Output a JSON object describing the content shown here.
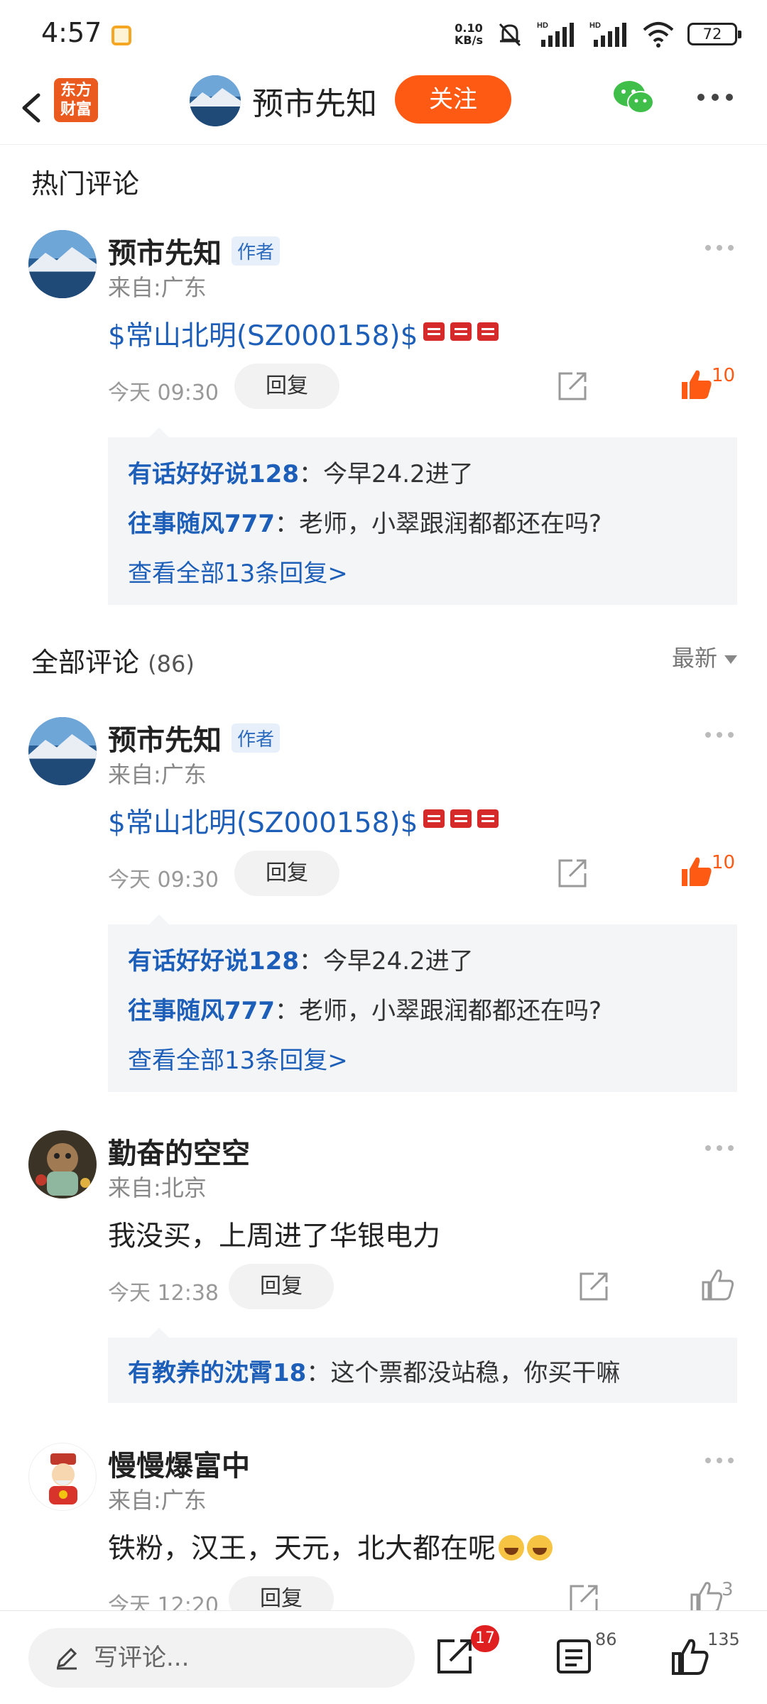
{
  "status_bar": {
    "time": "4:57",
    "speed_top": "0.10",
    "speed_bottom": "KB/s",
    "battery": "72",
    "icons": [
      "app-notification-icon",
      "mute-bell-icon",
      "hd-signal-icon",
      "hd-signal-icon",
      "wifi-icon",
      "battery-icon"
    ]
  },
  "header": {
    "brand_logo_line1": "东方",
    "brand_logo_line2": "财富",
    "title": "预市先知",
    "follow_label": "关注",
    "accent": "#ff5a14"
  },
  "hot_section": {
    "title": "热门评论"
  },
  "all_section": {
    "title": "全部评论",
    "count": "(86)",
    "sort_label": "最新"
  },
  "comments": [
    {
      "user": "预市先知",
      "tag": "作者",
      "from": "来自:广东",
      "content": "$常山北明(SZ000158)$",
      "time": "今天 09:30",
      "reply_label": "回复",
      "likes": "10",
      "replies": [
        {
          "user": "有话好好说128",
          "text": "：今早24.2进了"
        },
        {
          "user": "往事随风777",
          "text": "：老师，小翠跟润都都还在吗?"
        }
      ],
      "more": "查看全部13条回复>"
    },
    {
      "user": "预市先知",
      "tag": "作者",
      "from": "来自:广东",
      "content": "$常山北明(SZ000158)$",
      "time": "今天 09:30",
      "reply_label": "回复",
      "likes": "10",
      "replies": [
        {
          "user": "有话好好说128",
          "text": "：今早24.2进了"
        },
        {
          "user": "往事随风777",
          "text": "：老师，小翠跟润都都还在吗?"
        }
      ],
      "more": "查看全部13条回复>"
    },
    {
      "user": "勤奋的空空",
      "from": "来自:北京",
      "content": "我没买，上周进了华银电力",
      "time": "今天 12:38",
      "reply_label": "回复",
      "replies": [
        {
          "user": "有教养的沈霄18",
          "text": "：这个票都没站稳，你买干嘛"
        }
      ]
    },
    {
      "user": "慢慢爆富中",
      "from": "来自:广东",
      "content": "铁粉，汉王，天元，北大都在呢",
      "time": "今天 12:20",
      "reply_label": "回复",
      "likes": "3"
    }
  ],
  "bottom_bar": {
    "placeholder": "写评论...",
    "share_badge": "17",
    "comment_count": "86",
    "like_count": "135"
  }
}
